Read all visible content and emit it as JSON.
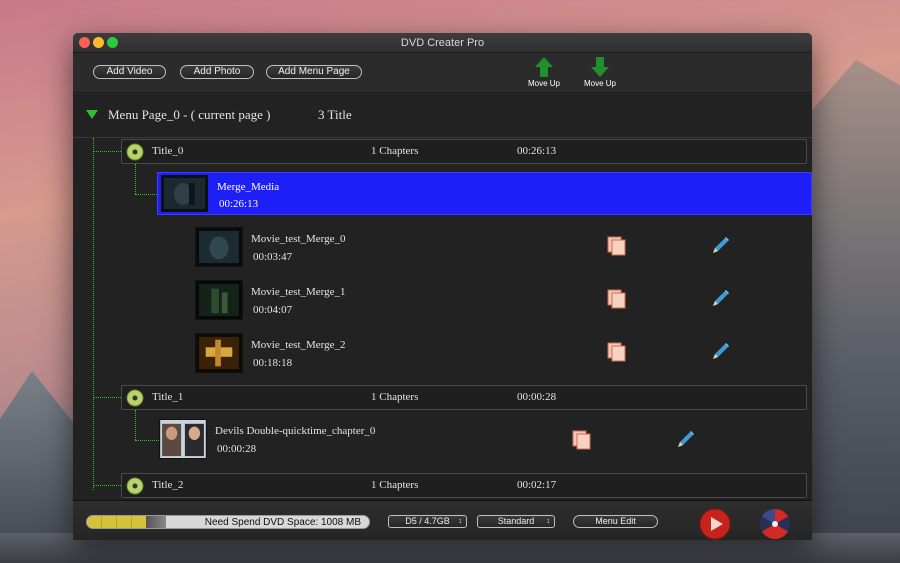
{
  "window": {
    "title": "DVD Creater Pro"
  },
  "toolbar": {
    "add_video": "Add Video",
    "add_photo": "Add Photo",
    "add_menu_page": "Add Menu Page",
    "move_up_1": "Move Up",
    "move_up_2": "Move Up"
  },
  "menu_page": {
    "label": "Menu Page_0  -  ( current page )",
    "title_count": "3 Title"
  },
  "titles": [
    {
      "name": "Title_0",
      "chapters": "1 Chapters",
      "duration": "00:26:13"
    },
    {
      "name": "Title_1",
      "chapters": "1 Chapters",
      "duration": "00:00:28"
    },
    {
      "name": "Title_2",
      "chapters": "1 Chapters",
      "duration": "00:02:17"
    }
  ],
  "merge": {
    "name": "Merge_Media",
    "duration": "00:26:13"
  },
  "clips": [
    {
      "name": "Movie_test_Merge_0",
      "duration": "00:03:47"
    },
    {
      "name": "Movie_test_Merge_1",
      "duration": "00:04:07"
    },
    {
      "name": "Movie_test_Merge_2",
      "duration": "00:18:18"
    },
    {
      "name": "Devils Double-quicktime_chapter_0",
      "duration": "00:00:28"
    }
  ],
  "bottom": {
    "space_text": "Need Spend DVD Space: 1008 MB",
    "space_fraction": 0.21,
    "disc_select": "D5 / 4.7GB",
    "quality_select": "Standard",
    "menu_edit": "Menu Edit"
  },
  "colors": {
    "selection": "#1e1ef7",
    "tree_line": "#2fbf2f",
    "arrow_green": "#1f8f2f"
  },
  "icons": {
    "copy": "copy-icon",
    "edit": "pencil-icon",
    "disc": "disc-icon",
    "play": "play-icon",
    "burn": "burn-icon"
  }
}
